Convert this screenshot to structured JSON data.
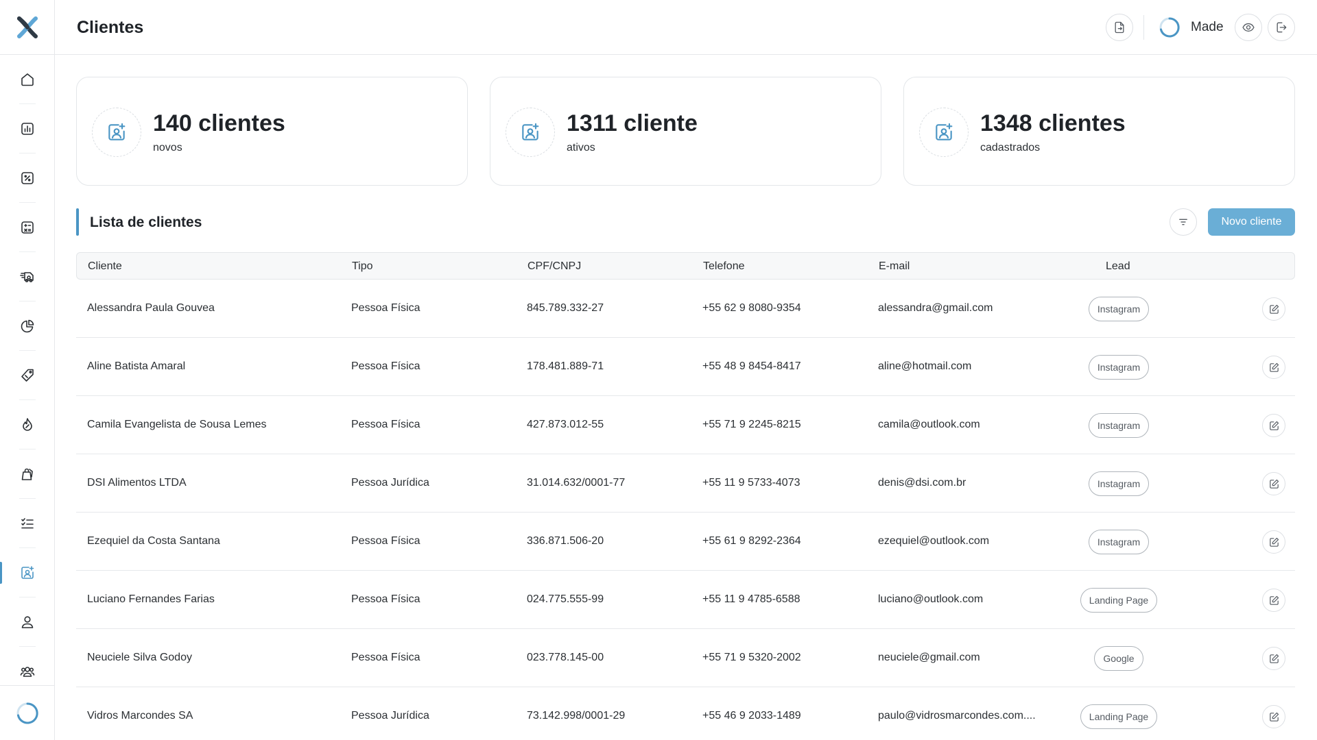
{
  "header": {
    "title": "Clientes",
    "user_name": "Made",
    "icons": [
      "document-export-icon",
      "eye-icon",
      "logout-icon"
    ]
  },
  "sidebar": {
    "items": [
      {
        "icon": "home-icon"
      },
      {
        "icon": "bar-chart-icon"
      },
      {
        "icon": "percent-icon"
      },
      {
        "icon": "calculator-icon"
      },
      {
        "icon": "truck-icon"
      },
      {
        "icon": "pie-chart-icon"
      },
      {
        "icon": "tag-icon"
      },
      {
        "icon": "flame-icon"
      },
      {
        "icon": "shopping-bag-icon"
      },
      {
        "icon": "checklist-icon"
      },
      {
        "icon": "customer-contact-icon",
        "active": true
      },
      {
        "icon": "user-icon"
      },
      {
        "icon": "users-icon"
      }
    ]
  },
  "stats": [
    {
      "value": "140 clientes",
      "label": "novos"
    },
    {
      "value": "1311 cliente",
      "label": "ativos"
    },
    {
      "value": "1348 clientes",
      "label": "cadastrados"
    }
  ],
  "list": {
    "title": "Lista de clientes",
    "new_button": "Novo cliente",
    "columns": [
      "Cliente",
      "Tipo",
      "CPF/CNPJ",
      "Telefone",
      "E-mail",
      "Lead"
    ],
    "rows": [
      {
        "cliente": "Alessandra Paula Gouvea",
        "tipo": "Pessoa Física",
        "doc": "845.789.332-27",
        "telefone": "+55 62 9 8080-9354",
        "email": "alessandra@gmail.com",
        "lead": "Instagram"
      },
      {
        "cliente": "Aline Batista Amaral",
        "tipo": "Pessoa Física",
        "doc": "178.481.889-71",
        "telefone": "+55 48 9 8454-8417",
        "email": "aline@hotmail.com",
        "lead": "Instagram"
      },
      {
        "cliente": "Camila Evangelista de Sousa Lemes",
        "tipo": "Pessoa Física",
        "doc": "427.873.012-55",
        "telefone": "+55 71 9 2245-8215",
        "email": "camila@outlook.com",
        "lead": "Instagram"
      },
      {
        "cliente": "DSI Alimentos LTDA",
        "tipo": "Pessoa Jurídica",
        "doc": "31.014.632/0001-77",
        "telefone": "+55 11 9 5733-4073",
        "email": "denis@dsi.com.br",
        "lead": "Instagram"
      },
      {
        "cliente": "Ezequiel da Costa Santana",
        "tipo": "Pessoa Física",
        "doc": "336.871.506-20",
        "telefone": "+55 61 9 8292-2364",
        "email": "ezequiel@outlook.com",
        "lead": "Instagram"
      },
      {
        "cliente": "Luciano Fernandes Farias",
        "tipo": "Pessoa Física",
        "doc": "024.775.555-99",
        "telefone": "+55 11 9 4785-6588",
        "email": "luciano@outlook.com",
        "lead": "Landing Page"
      },
      {
        "cliente": "Neuciele Silva Godoy",
        "tipo": "Pessoa Física",
        "doc": "023.778.145-00",
        "telefone": "+55 71 9 5320-2002",
        "email": "neuciele@gmail.com",
        "lead": "Google"
      },
      {
        "cliente": "Vidros Marcondes SA",
        "tipo": "Pessoa Jurídica",
        "doc": "73.142.998/0001-29",
        "telefone": "+55 46 9 2033-1489",
        "email": "paulo@vidrosmarcondes.com....",
        "lead": "Landing Page"
      }
    ]
  },
  "colors": {
    "accent": "#4a95c4",
    "button": "#6aaed6",
    "logo_primary": "#2f3a45",
    "logo_secondary": "#5fa7d6"
  }
}
